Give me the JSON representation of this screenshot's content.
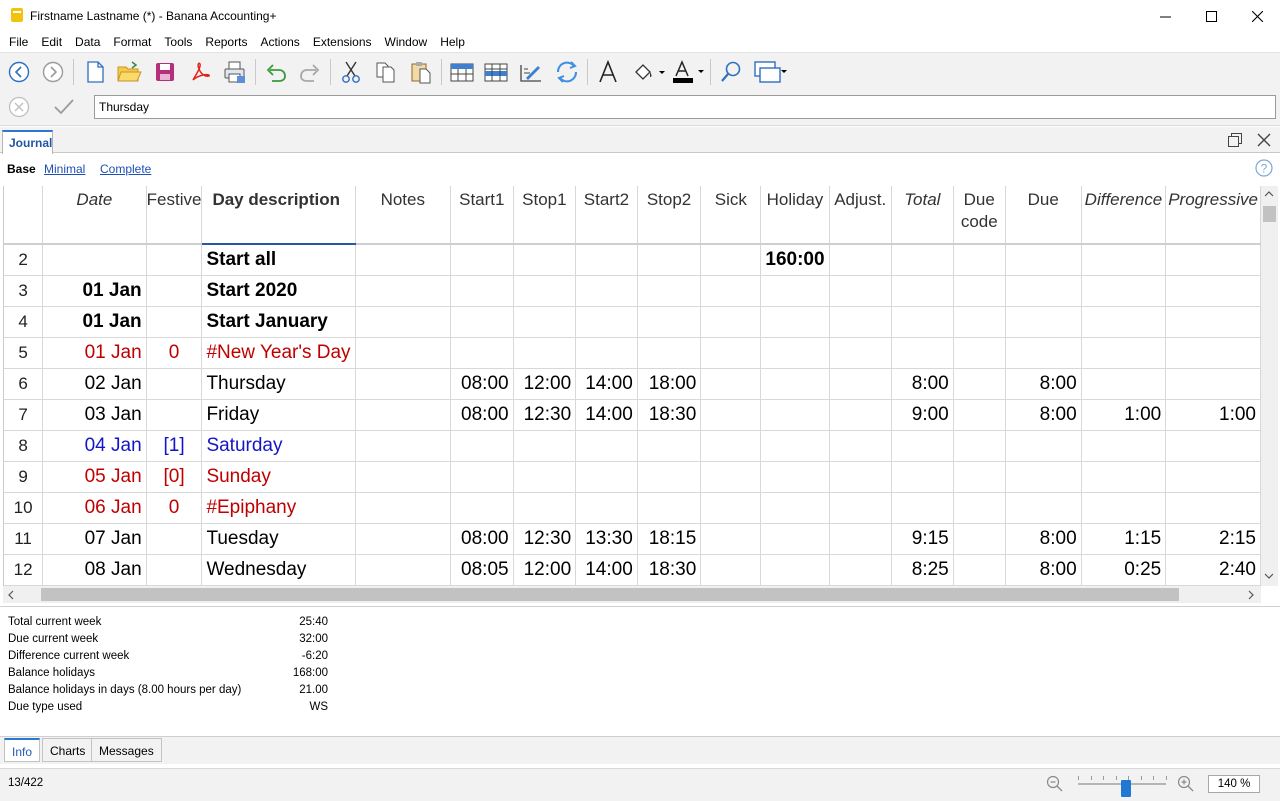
{
  "window": {
    "title": "Firstname Lastname (*) - Banana Accounting+",
    "minimize": "—",
    "maximize": "☐",
    "close": "✕"
  },
  "menu": [
    "File",
    "Edit",
    "Data",
    "Format",
    "Tools",
    "Reports",
    "Actions",
    "Extensions",
    "Window",
    "Help"
  ],
  "toolbar_icons": [
    "back-icon",
    "forward-icon",
    "new-file-icon",
    "open-folder-icon",
    "save-icon",
    "pdf-icon",
    "print-icon",
    "undo-icon",
    "redo-icon",
    "cut-icon",
    "copy-icon",
    "paste-icon",
    "insert-rows-icon",
    "add-rows-icon",
    "edit-columns-icon",
    "recalculate-icon",
    "font-icon",
    "fill-color-icon",
    "text-color-icon",
    "find-icon",
    "window-icon"
  ],
  "edit_bar": {
    "value": "Thursday"
  },
  "tabs": {
    "active": "Journal"
  },
  "views": [
    "Base",
    "Minimal",
    "Complete"
  ],
  "columns": [
    {
      "label": "Date",
      "italic": true
    },
    {
      "label": "Festive",
      "italic": false
    },
    {
      "label": "Day description",
      "italic": false
    },
    {
      "label": "Notes",
      "italic": false
    },
    {
      "label": "Start1",
      "italic": false
    },
    {
      "label": "Stop1",
      "italic": false
    },
    {
      "label": "Start2",
      "italic": false
    },
    {
      "label": "Stop2",
      "italic": false
    },
    {
      "label": "Sick",
      "italic": false
    },
    {
      "label": "Holiday",
      "italic": false
    },
    {
      "label": "Adjust.",
      "italic": false
    },
    {
      "label": "Total",
      "italic": true
    },
    {
      "label": "Due code",
      "italic": false
    },
    {
      "label": "Due",
      "italic": false
    },
    {
      "label": "Difference",
      "italic": true
    },
    {
      "label": "Progressive",
      "italic": true
    }
  ],
  "rows": [
    {
      "n": "2",
      "style": "bold",
      "cells": [
        "",
        "",
        "Start all",
        "",
        "",
        "",
        "",
        "",
        "",
        "160:00",
        "",
        "",
        "",
        "",
        "",
        ""
      ]
    },
    {
      "n": "3",
      "style": "bold",
      "cells": [
        "01 Jan",
        "",
        "Start 2020",
        "",
        "",
        "",
        "",
        "",
        "",
        "",
        "",
        "",
        "",
        "",
        "",
        ""
      ]
    },
    {
      "n": "4",
      "style": "bold",
      "cells": [
        "01 Jan",
        "",
        "Start January",
        "",
        "",
        "",
        "",
        "",
        "",
        "",
        "",
        "",
        "",
        "",
        "",
        ""
      ]
    },
    {
      "n": "5",
      "style": "red",
      "cells": [
        "01 Jan",
        "0",
        "#New Year's Day",
        "",
        "",
        "",
        "",
        "",
        "",
        "",
        "",
        "",
        "",
        "",
        "",
        ""
      ]
    },
    {
      "n": "6",
      "style": "",
      "cells": [
        "02 Jan",
        "",
        "Thursday",
        "",
        "08:00",
        "12:00",
        "14:00",
        "18:00",
        "",
        "",
        "",
        "8:00",
        "",
        "8:00",
        "",
        ""
      ]
    },
    {
      "n": "7",
      "style": "",
      "cells": [
        "03 Jan",
        "",
        "Friday",
        "",
        "08:00",
        "12:30",
        "14:00",
        "18:30",
        "",
        "",
        "",
        "9:00",
        "",
        "8:00",
        "1:00",
        "1:00"
      ]
    },
    {
      "n": "8",
      "style": "blue",
      "cells": [
        "04 Jan",
        "[1]",
        "Saturday",
        "",
        "",
        "",
        "",
        "",
        "",
        "",
        "",
        "",
        "",
        "",
        "",
        ""
      ]
    },
    {
      "n": "9",
      "style": "red",
      "cells": [
        "05 Jan",
        "[0]",
        "Sunday",
        "",
        "",
        "",
        "",
        "",
        "",
        "",
        "",
        "",
        "",
        "",
        "",
        ""
      ]
    },
    {
      "n": "10",
      "style": "red",
      "cells": [
        "06 Jan",
        "0",
        "#Epiphany",
        "",
        "",
        "",
        "",
        "",
        "",
        "",
        "",
        "",
        "",
        "",
        "",
        ""
      ]
    },
    {
      "n": "11",
      "style": "",
      "cells": [
        "07 Jan",
        "",
        "Tuesday",
        "",
        "08:00",
        "12:30",
        "13:30",
        "18:15",
        "",
        "",
        "",
        "9:15",
        "",
        "8:00",
        "1:15",
        "2:15"
      ]
    },
    {
      "n": "12",
      "style": "",
      "cells": [
        "08 Jan",
        "",
        "Wednesday",
        "",
        "08:05",
        "12:00",
        "14:00",
        "18:30",
        "",
        "",
        "",
        "8:25",
        "",
        "8:00",
        "0:25",
        "2:40"
      ]
    }
  ],
  "info": [
    {
      "label": "Total current week",
      "value": "25:40"
    },
    {
      "label": "Due current week",
      "value": "32:00"
    },
    {
      "label": "Difference current week",
      "value": "-6:20"
    },
    {
      "label": "Balance holidays",
      "value": "168:00"
    },
    {
      "label": "Balance holidays in days (8.00 hours per day)",
      "value": "21.00"
    },
    {
      "label": "Due type used",
      "value": "WS"
    }
  ],
  "bottom_tabs": [
    "Info",
    "Charts",
    "Messages"
  ],
  "status": {
    "position": "13/422",
    "zoom": "140 %",
    "zoom_level": 0.4
  }
}
